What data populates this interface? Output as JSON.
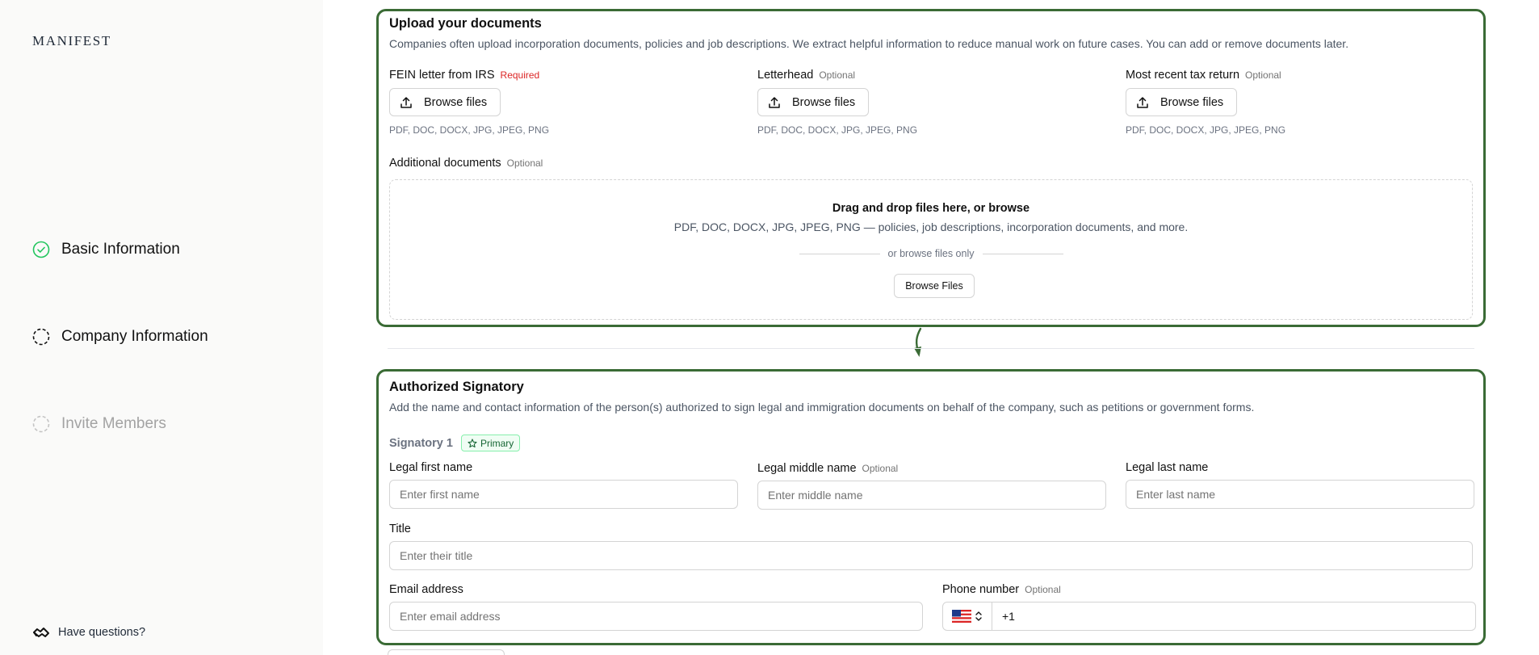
{
  "sidebar": {
    "logo": "MANIFEST",
    "steps": [
      {
        "label": "Basic Information",
        "state": "complete"
      },
      {
        "label": "Company Information",
        "state": "current"
      },
      {
        "label": "Invite Members",
        "state": "upcoming"
      }
    ],
    "help": "Have questions?"
  },
  "upload": {
    "title": "Upload your documents",
    "description": "Companies often upload incorporation documents, policies and job descriptions. We extract helpful information to reduce manual work on future cases. You can add or remove documents later.",
    "fields": [
      {
        "label": "FEIN letter from IRS",
        "tag": "Required",
        "button": "Browse files",
        "formats": "PDF, DOC, DOCX, JPG, JPEG, PNG"
      },
      {
        "label": "Letterhead",
        "tag": "Optional",
        "button": "Browse files",
        "formats": "PDF, DOC, DOCX, JPG, JPEG, PNG"
      },
      {
        "label": "Most recent tax return",
        "tag": "Optional",
        "button": "Browse files",
        "formats": "PDF, DOC, DOCX, JPG, JPEG, PNG"
      }
    ],
    "additional": {
      "label": "Additional documents",
      "tag": "Optional"
    },
    "dropzone": {
      "title": "Drag and drop files here, or browse",
      "subtitle": "PDF, DOC, DOCX, JPG, JPEG, PNG — policies, job descriptions, incorporation documents, and more.",
      "or_text": "or browse files only",
      "button": "Browse Files"
    }
  },
  "signatory": {
    "title": "Authorized Signatory",
    "description": "Add the name and contact information of the person(s) authorized to sign legal and immigration documents on behalf of the company, such as petitions or government forms.",
    "label": "Signatory 1",
    "badge": "Primary",
    "first": {
      "label": "Legal first name",
      "placeholder": "Enter first name"
    },
    "middle": {
      "label": "Legal middle name",
      "tag": "Optional",
      "placeholder": "Enter middle name"
    },
    "last": {
      "label": "Legal last name",
      "placeholder": "Enter last name"
    },
    "title_field": {
      "label": "Title",
      "placeholder": "Enter their title"
    },
    "email": {
      "label": "Email address",
      "placeholder": "Enter email address"
    },
    "phone": {
      "label": "Phone number",
      "tag": "Optional",
      "code": "+1"
    }
  },
  "colors": {
    "accent": "#3a6b35",
    "required": "#dc2626",
    "success": "#22c55e"
  }
}
